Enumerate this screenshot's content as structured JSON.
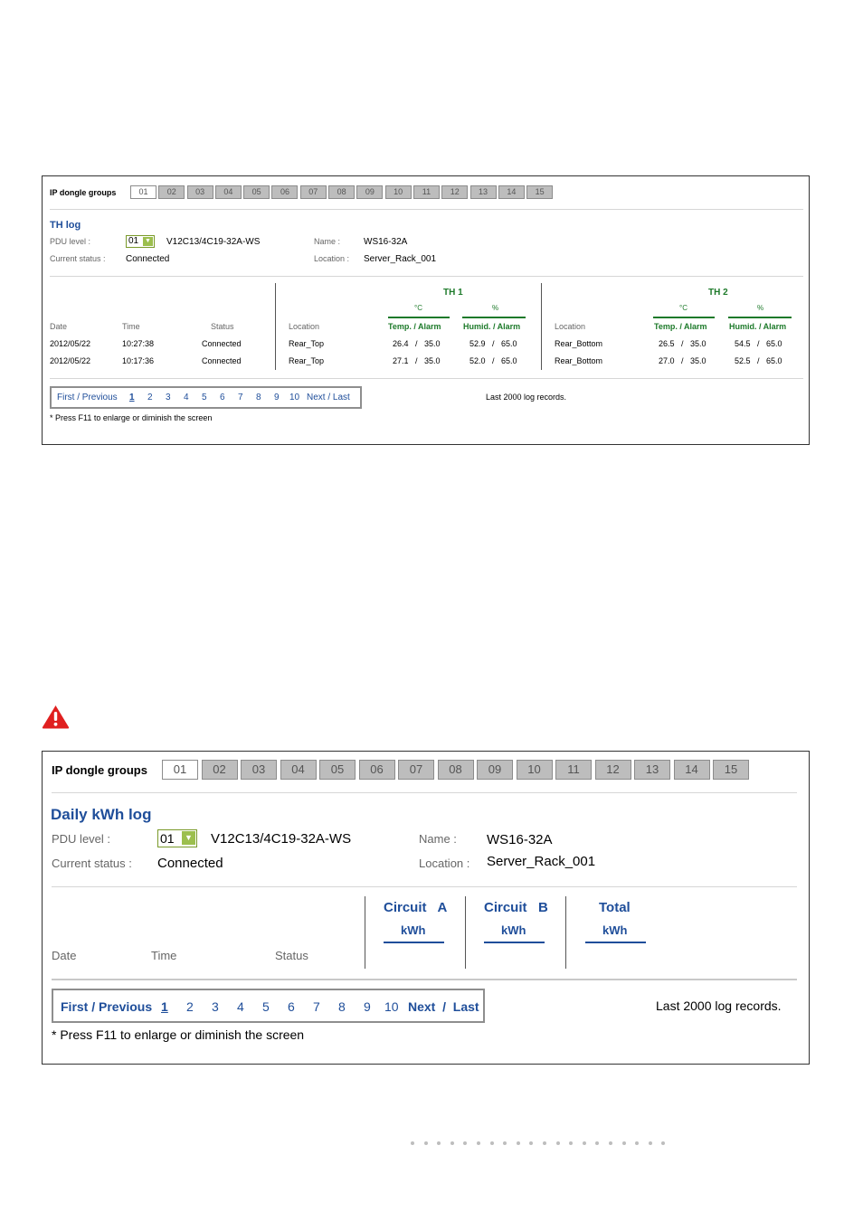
{
  "th_panel": {
    "groups_label": "IP dongle groups",
    "groups": [
      "01",
      "02",
      "03",
      "04",
      "05",
      "06",
      "07",
      "08",
      "09",
      "10",
      "11",
      "12",
      "13",
      "14",
      "15"
    ],
    "title": "TH log",
    "pdu_level_label": "PDU level :",
    "pdu_level_value": "01",
    "pdu_model": "V12C13/4C19-32A-WS",
    "status_label": "Current status :",
    "status_value": "Connected",
    "name_label": "Name :",
    "name_value": "WS16-32A",
    "location_label": "Location :",
    "location_value": "Server_Rack_001",
    "col_date": "Date",
    "col_time": "Time",
    "col_status": "Status",
    "th1": {
      "title": "TH   1",
      "unit_c": "°C",
      "unit_pct": "%",
      "col_location": "Location",
      "col_temp": "Temp. / Alarm",
      "col_humid": "Humid. / Alarm"
    },
    "th2": {
      "title": "TH   2",
      "unit_c": "°C",
      "unit_pct": "%",
      "col_location": "Location",
      "col_temp": "Temp. / Alarm",
      "col_humid": "Humid. / Alarm"
    },
    "rows": [
      {
        "date": "2012/05/22",
        "time": "10:27:38",
        "status": "Connected",
        "loc1": "Rear_Top",
        "temp1": "26.4   /   35.0",
        "humid1": "52.9   /   65.0",
        "loc2": "Rear_Bottom",
        "temp2": "26.5   /   35.0",
        "humid2": "54.5   /   65.0"
      },
      {
        "date": "2012/05/22",
        "time": "10:17:36",
        "status": "Connected",
        "loc1": "Rear_Top",
        "temp1": "27.1   /   35.0",
        "humid1": "52.0   /   65.0",
        "loc2": "Rear_Bottom",
        "temp2": "27.0   /   35.0",
        "humid2": "52.5   /   65.0"
      }
    ],
    "pager": {
      "first_prev": "First  / Previous",
      "pages": [
        "1",
        "2",
        "3",
        "4",
        "5",
        "6",
        "7",
        "8",
        "9",
        "10"
      ],
      "next_last": "Next  / Last"
    },
    "records_note": "Last 2000 log records.",
    "hint": "* Press F11 to enlarge or diminish the screen"
  },
  "kwh_panel": {
    "groups_label": "IP dongle groups",
    "groups": [
      "01",
      "02",
      "03",
      "04",
      "05",
      "06",
      "07",
      "08",
      "09",
      "10",
      "11",
      "12",
      "13",
      "14",
      "15"
    ],
    "title": "Daily kWh log",
    "pdu_level_label": "PDU level :",
    "pdu_level_value": "01",
    "pdu_model": "V12C13/4C19-32A-WS",
    "status_label": "Current status :",
    "status_value": "Connected",
    "name_label": "Name :",
    "name_value": "WS16-32A",
    "location_label": "Location :",
    "location_value": "Server_Rack_001",
    "col_date": "Date",
    "col_time": "Time",
    "col_status": "Status",
    "circuit_a": {
      "title": "Circuit   A",
      "unit": "kWh"
    },
    "circuit_b": {
      "title": "Circuit   B",
      "unit": "kWh"
    },
    "total": {
      "title": "Total",
      "unit": "kWh"
    },
    "pager": {
      "first_prev": "First  / Previous",
      "pages": [
        "1",
        "2",
        "3",
        "4",
        "5",
        "6",
        "7",
        "8",
        "9",
        "10"
      ],
      "next_last": "Next  /  Last"
    },
    "records_note": "Last 2000 log records.",
    "hint": "* Press F11 to enlarge or diminish the screen"
  },
  "colors": {
    "link_blue": "#1f4e9a",
    "header_green": "#1d7a2a",
    "tab_gray": "#bdbdbd",
    "warning_red": "#e02020"
  }
}
